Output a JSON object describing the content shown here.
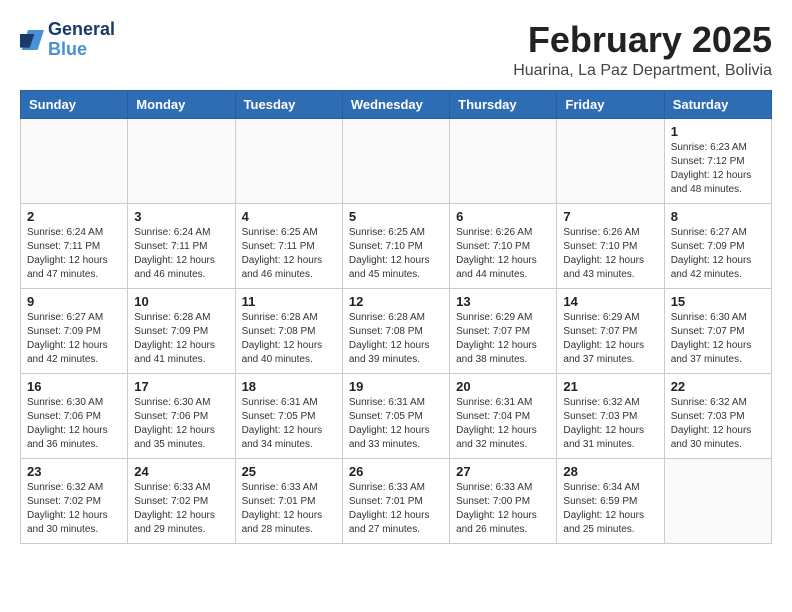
{
  "logo": {
    "line1": "General",
    "line2": "Blue"
  },
  "title": "February 2025",
  "subtitle": "Huarina, La Paz Department, Bolivia",
  "weekdays": [
    "Sunday",
    "Monday",
    "Tuesday",
    "Wednesday",
    "Thursday",
    "Friday",
    "Saturday"
  ],
  "weeks": [
    [
      {
        "day": "",
        "info": ""
      },
      {
        "day": "",
        "info": ""
      },
      {
        "day": "",
        "info": ""
      },
      {
        "day": "",
        "info": ""
      },
      {
        "day": "",
        "info": ""
      },
      {
        "day": "",
        "info": ""
      },
      {
        "day": "1",
        "info": "Sunrise: 6:23 AM\nSunset: 7:12 PM\nDaylight: 12 hours\nand 48 minutes."
      }
    ],
    [
      {
        "day": "2",
        "info": "Sunrise: 6:24 AM\nSunset: 7:11 PM\nDaylight: 12 hours\nand 47 minutes."
      },
      {
        "day": "3",
        "info": "Sunrise: 6:24 AM\nSunset: 7:11 PM\nDaylight: 12 hours\nand 46 minutes."
      },
      {
        "day": "4",
        "info": "Sunrise: 6:25 AM\nSunset: 7:11 PM\nDaylight: 12 hours\nand 46 minutes."
      },
      {
        "day": "5",
        "info": "Sunrise: 6:25 AM\nSunset: 7:10 PM\nDaylight: 12 hours\nand 45 minutes."
      },
      {
        "day": "6",
        "info": "Sunrise: 6:26 AM\nSunset: 7:10 PM\nDaylight: 12 hours\nand 44 minutes."
      },
      {
        "day": "7",
        "info": "Sunrise: 6:26 AM\nSunset: 7:10 PM\nDaylight: 12 hours\nand 43 minutes."
      },
      {
        "day": "8",
        "info": "Sunrise: 6:27 AM\nSunset: 7:09 PM\nDaylight: 12 hours\nand 42 minutes."
      }
    ],
    [
      {
        "day": "9",
        "info": "Sunrise: 6:27 AM\nSunset: 7:09 PM\nDaylight: 12 hours\nand 42 minutes."
      },
      {
        "day": "10",
        "info": "Sunrise: 6:28 AM\nSunset: 7:09 PM\nDaylight: 12 hours\nand 41 minutes."
      },
      {
        "day": "11",
        "info": "Sunrise: 6:28 AM\nSunset: 7:08 PM\nDaylight: 12 hours\nand 40 minutes."
      },
      {
        "day": "12",
        "info": "Sunrise: 6:28 AM\nSunset: 7:08 PM\nDaylight: 12 hours\nand 39 minutes."
      },
      {
        "day": "13",
        "info": "Sunrise: 6:29 AM\nSunset: 7:07 PM\nDaylight: 12 hours\nand 38 minutes."
      },
      {
        "day": "14",
        "info": "Sunrise: 6:29 AM\nSunset: 7:07 PM\nDaylight: 12 hours\nand 37 minutes."
      },
      {
        "day": "15",
        "info": "Sunrise: 6:30 AM\nSunset: 7:07 PM\nDaylight: 12 hours\nand 37 minutes."
      }
    ],
    [
      {
        "day": "16",
        "info": "Sunrise: 6:30 AM\nSunset: 7:06 PM\nDaylight: 12 hours\nand 36 minutes."
      },
      {
        "day": "17",
        "info": "Sunrise: 6:30 AM\nSunset: 7:06 PM\nDaylight: 12 hours\nand 35 minutes."
      },
      {
        "day": "18",
        "info": "Sunrise: 6:31 AM\nSunset: 7:05 PM\nDaylight: 12 hours\nand 34 minutes."
      },
      {
        "day": "19",
        "info": "Sunrise: 6:31 AM\nSunset: 7:05 PM\nDaylight: 12 hours\nand 33 minutes."
      },
      {
        "day": "20",
        "info": "Sunrise: 6:31 AM\nSunset: 7:04 PM\nDaylight: 12 hours\nand 32 minutes."
      },
      {
        "day": "21",
        "info": "Sunrise: 6:32 AM\nSunset: 7:03 PM\nDaylight: 12 hours\nand 31 minutes."
      },
      {
        "day": "22",
        "info": "Sunrise: 6:32 AM\nSunset: 7:03 PM\nDaylight: 12 hours\nand 30 minutes."
      }
    ],
    [
      {
        "day": "23",
        "info": "Sunrise: 6:32 AM\nSunset: 7:02 PM\nDaylight: 12 hours\nand 30 minutes."
      },
      {
        "day": "24",
        "info": "Sunrise: 6:33 AM\nSunset: 7:02 PM\nDaylight: 12 hours\nand 29 minutes."
      },
      {
        "day": "25",
        "info": "Sunrise: 6:33 AM\nSunset: 7:01 PM\nDaylight: 12 hours\nand 28 minutes."
      },
      {
        "day": "26",
        "info": "Sunrise: 6:33 AM\nSunset: 7:01 PM\nDaylight: 12 hours\nand 27 minutes."
      },
      {
        "day": "27",
        "info": "Sunrise: 6:33 AM\nSunset: 7:00 PM\nDaylight: 12 hours\nand 26 minutes."
      },
      {
        "day": "28",
        "info": "Sunrise: 6:34 AM\nSunset: 6:59 PM\nDaylight: 12 hours\nand 25 minutes."
      },
      {
        "day": "",
        "info": ""
      }
    ]
  ]
}
